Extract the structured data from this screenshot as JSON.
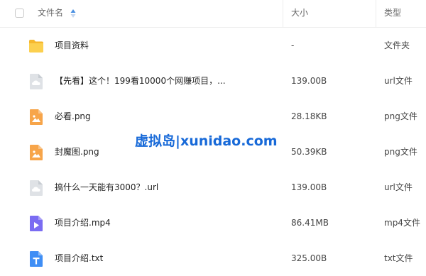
{
  "header": {
    "name_label": "文件名",
    "size_label": "大小",
    "type_label": "类型"
  },
  "files": [
    {
      "name": "项目资料",
      "size": "-",
      "type": "文件夹",
      "icon": "folder-icon"
    },
    {
      "name": "【先看】这个！199看10000个网赚项目，...",
      "size": "139.00B",
      "type": "url文件",
      "icon": "cloud-link-icon"
    },
    {
      "name": "必看.png",
      "size": "28.18KB",
      "type": "png文件",
      "icon": "image-icon"
    },
    {
      "name": "封魔图.png",
      "size": "50.39KB",
      "type": "png文件",
      "icon": "image-icon"
    },
    {
      "name": "搞什么一天能有3000？.url",
      "size": "139.00B",
      "type": "url文件",
      "icon": "cloud-link-icon"
    },
    {
      "name": "项目介绍.mp4",
      "size": "86.41MB",
      "type": "mp4文件",
      "icon": "video-icon"
    },
    {
      "name": "项目介绍.txt",
      "size": "325.00B",
      "type": "txt文件",
      "icon": "text-file-icon"
    }
  ],
  "watermark": "虚拟岛|xunidao.com",
  "colors": {
    "folder": "#f9c73d",
    "image": "#f7a54a",
    "video": "#7a6cf2",
    "text": "#3f8ef5",
    "cloud": "#d7dbe0",
    "watermark": "#1769d8"
  }
}
